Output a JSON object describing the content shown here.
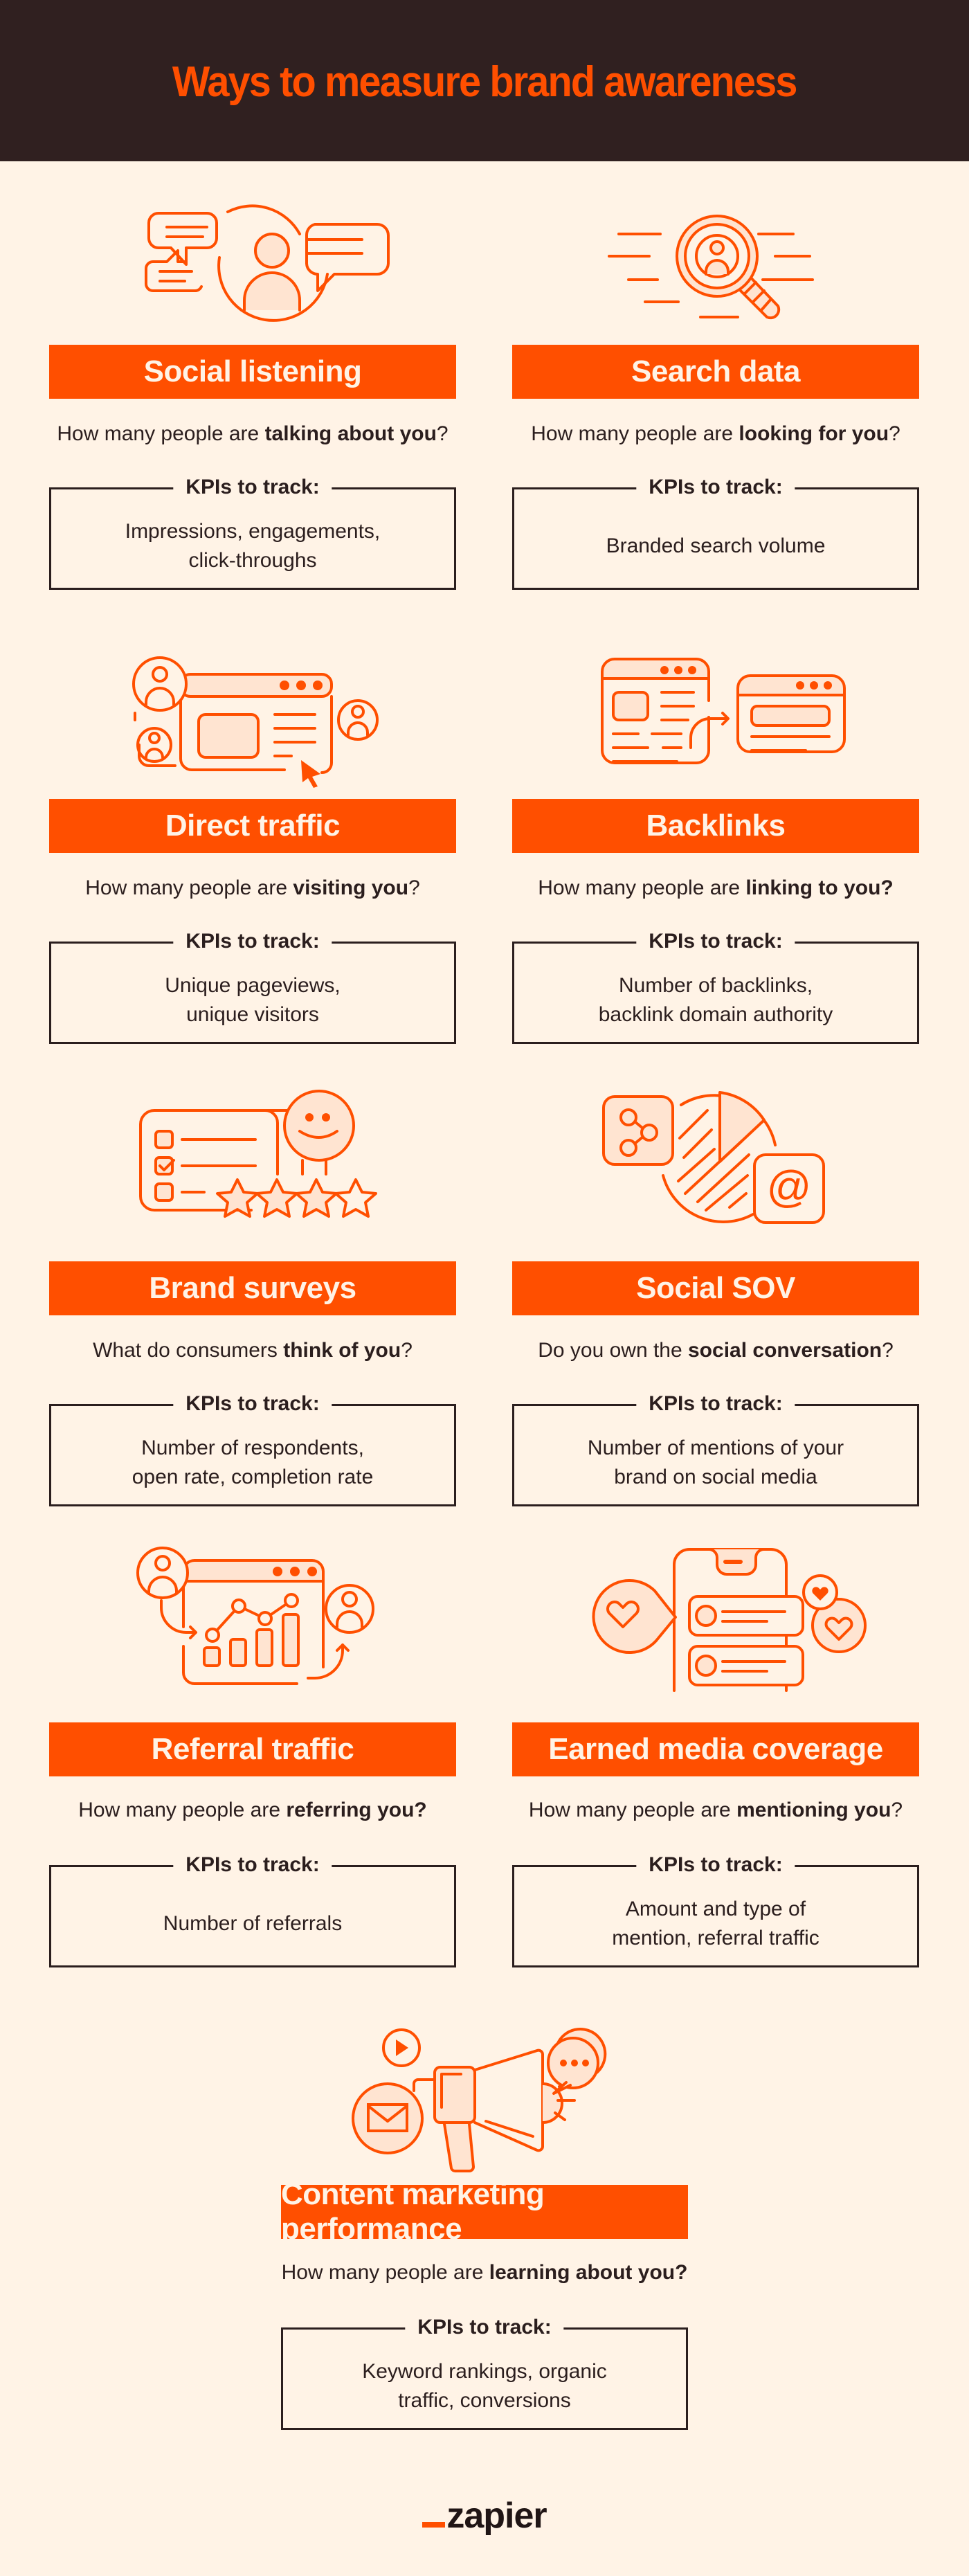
{
  "header": {
    "title": "Ways to measure brand awareness"
  },
  "colors": {
    "accent": "#ff4f00",
    "header_bg": "#302020",
    "page_bg": "#fff3e6",
    "text": "#2b1e1e",
    "icon_fill": "#ffe4d1"
  },
  "kpi_label": "KPIs to track:",
  "cards": [
    {
      "title": "Social listening",
      "icon": "person-speech-bubbles-icon",
      "question_pre": "How many people are ",
      "question_bold": "talking about you",
      "question_post": "?",
      "kpis": "Impressions, engagements,\nclick-throughs"
    },
    {
      "title": "Search data",
      "icon": "magnifier-person-icon",
      "question_pre": "How many people are ",
      "question_bold": "looking for you",
      "question_post": "?",
      "kpis": "Branded search volume"
    },
    {
      "title": "Direct traffic",
      "icon": "browser-visitors-cursor-icon",
      "question_pre": "How many people are ",
      "question_bold": "visiting you",
      "question_post": "?",
      "kpis": "Unique pageviews,\nunique visitors"
    },
    {
      "title": "Backlinks",
      "icon": "linked-browsers-icon",
      "question_pre": "How many people are ",
      "question_bold": "linking to you?",
      "question_post": "",
      "kpis": "Number of backlinks,\nbacklink domain authority"
    },
    {
      "title": "Brand surveys",
      "icon": "survey-stars-smiley-icon",
      "question_pre": "What do consumers ",
      "question_bold": "think of you",
      "question_post": "?",
      "kpis": "Number of respondents,\nopen rate, completion rate"
    },
    {
      "title": "Social SOV",
      "icon": "pie-share-at-icon",
      "question_pre": "Do you own the ",
      "question_bold": "social conversation",
      "question_post": "?",
      "kpis": "Number of mentions of your\nbrand on social media"
    },
    {
      "title": "Referral traffic",
      "icon": "referral-chart-icon",
      "question_pre": "How many people are ",
      "question_bold": "referring you?",
      "question_post": "",
      "kpis": "Number of referrals"
    },
    {
      "title": "Earned media coverage",
      "icon": "phone-hearts-icon",
      "question_pre": "How many people are ",
      "question_bold": "mentioning you",
      "question_post": "?",
      "kpis": "Amount and type of\nmention, referral traffic"
    },
    {
      "title": "Content marketing performance",
      "icon": "megaphone-icon",
      "question_pre": "How many people are ",
      "question_bold": "learning about you?",
      "question_post": "",
      "kpis": "Keyword rankings, organic\ntraffic, conversions"
    }
  ],
  "footer": {
    "logo_text": "zapier"
  }
}
